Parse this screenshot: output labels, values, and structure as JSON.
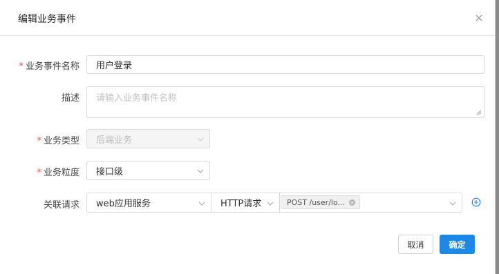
{
  "dialog": {
    "title": "编辑业务事件"
  },
  "form": {
    "name": {
      "label": "业务事件名称",
      "required": "*",
      "value": "用户登录"
    },
    "description": {
      "label": "描述",
      "placeholder": "请输入业务事件名称",
      "value": ""
    },
    "type": {
      "label": "业务类型",
      "required": "*",
      "value": "后端业务",
      "disabled": true
    },
    "granularity": {
      "label": "业务粒度",
      "required": "*",
      "value": "接口级"
    },
    "related_request": {
      "label": "关联请求",
      "service": "web应用服务",
      "protocol": "HTTP请求",
      "tag": "POST /user/lo..."
    }
  },
  "buttons": {
    "cancel": "取消",
    "ok": "确定"
  },
  "colors": {
    "primary": "#1e88e5",
    "required": "#e5534b"
  },
  "icons": [
    "close-icon",
    "chevron-down-icon",
    "tag-remove-icon",
    "add-circle-icon"
  ]
}
